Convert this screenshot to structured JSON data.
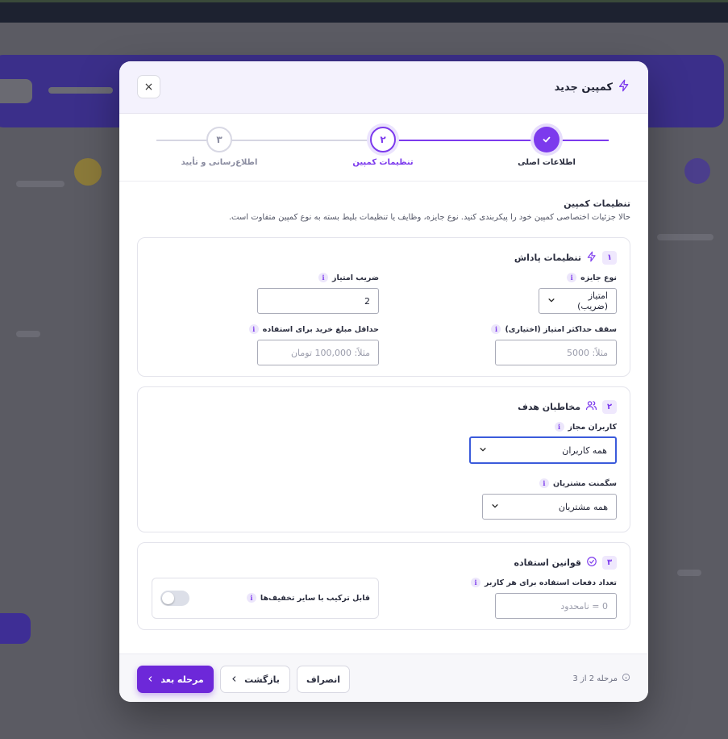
{
  "modal": {
    "title": "کمپین جدید",
    "close_glyph": "×"
  },
  "stepper": {
    "steps": [
      {
        "number": "✓",
        "label": "اطلاعات اصلی",
        "state": "done"
      },
      {
        "number": "۲",
        "label": "تنظیمات کمپین",
        "state": "active"
      },
      {
        "number": "۳",
        "label": "اطلاع‌رسانی و تأیید",
        "state": "pending"
      }
    ]
  },
  "section": {
    "title": "تنظیمات کمپین",
    "description": "حالا جزئیات اختصاصی کمپین خود را پیکربندی کنید. نوع جایزه، وظایف یا تنظیمات بلیط بسته به نوع کمپین متفاوت است."
  },
  "reward": {
    "index": "۱",
    "title": "تنظیمات پاداش",
    "prize_type_label": "نوع جایزه",
    "prize_type_value": "امتیاز (ضریب)",
    "multiplier_label": "ضریب امتیاز",
    "multiplier_value": "2",
    "max_points_label": "سقف حداکثر امتیاز (اختیاری)",
    "max_points_placeholder": "مثلاً: 5000",
    "min_purchase_label": "حداقل مبلغ خرید برای استفاده",
    "min_purchase_placeholder": "مثلاً: 100,000 تومان"
  },
  "audience": {
    "index": "۲",
    "title": "مخاطبان هدف",
    "allowed_users_label": "کاربران مجاز",
    "allowed_users_value": "همه کاربران",
    "segment_label": "سگمنت مشتریان",
    "segment_value": "همه مشتریان"
  },
  "usage": {
    "index": "۳",
    "title": "قوانین استفاده",
    "per_user_label": "تعداد دفعات استفاده برای هر کاربر",
    "per_user_placeholder": "0 = نامحدود",
    "combinable_label": "قابل ترکیب با سایر تخفیف‌ها",
    "combinable_on": false
  },
  "footer": {
    "step_info": "مرحله 2 از 3",
    "cancel": "انصراف",
    "back": "بازگشت",
    "next": "مرحله بعد"
  },
  "colors": {
    "accent": "#7c3aed",
    "focus": "#3b5bdb"
  }
}
